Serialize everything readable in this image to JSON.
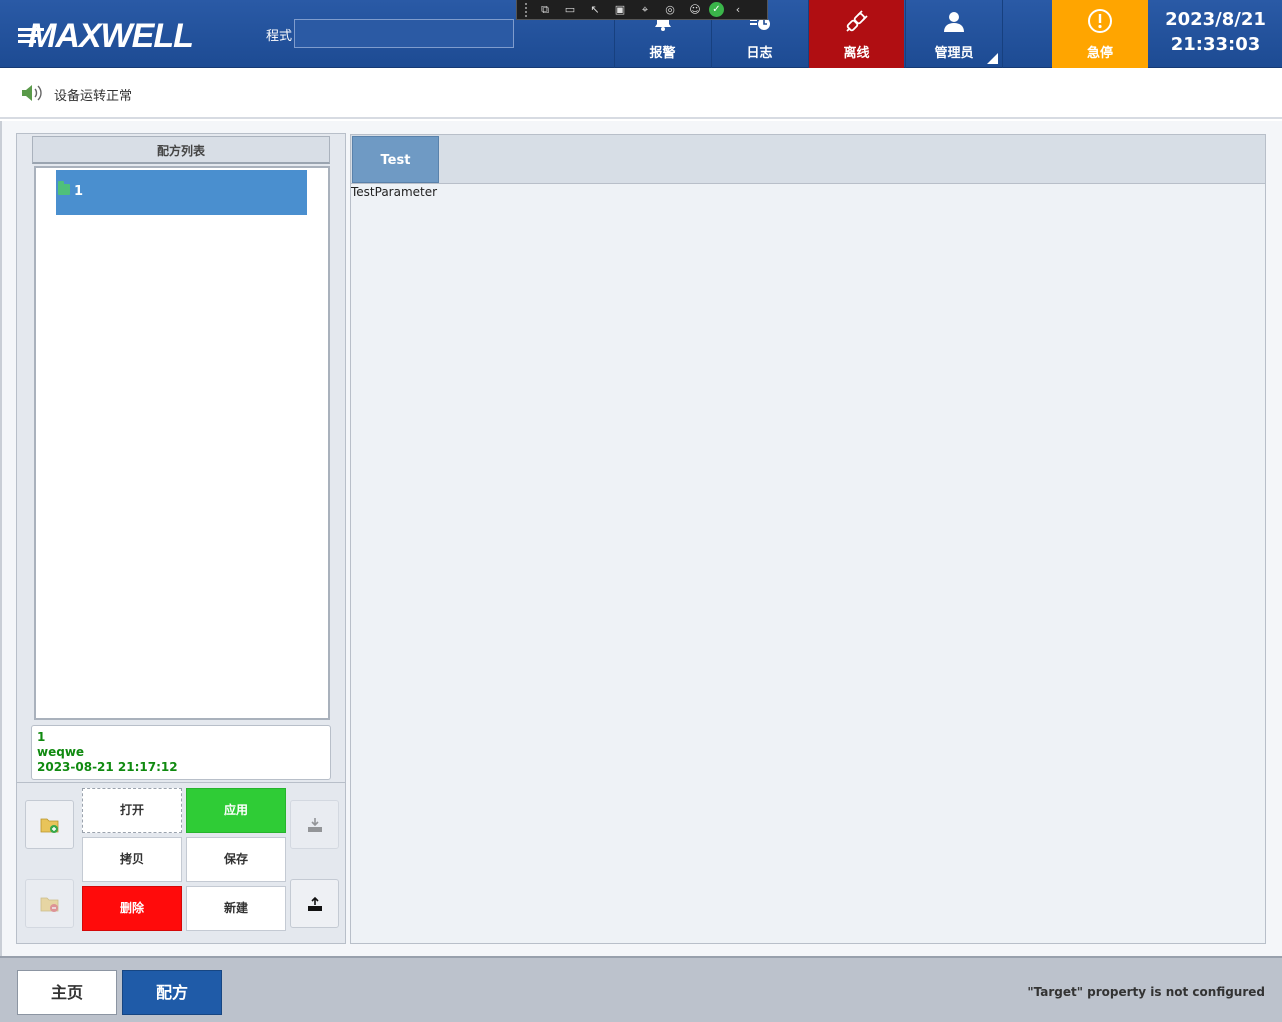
{
  "header": {
    "logo_text": "MAXWELL",
    "program_label": "程式",
    "program_value": "",
    "buttons": {
      "alarm": "报警",
      "log": "日志",
      "offline": "离线",
      "admin": "管理员",
      "estop": "急停"
    },
    "date": "2023/8/21",
    "time": "21:33:03",
    "colors": {
      "header_bg": "#1d4b93",
      "offline_bg": "#b00e12",
      "estop_bg": "#ffa500"
    }
  },
  "debug_toolbar": {
    "icons": [
      "live-visual-tree-icon",
      "record-icon",
      "select-element-icon",
      "display-layout-adorners-icon",
      "track-focus-icon",
      "binding-failures-icon",
      "accessibility-icon",
      "check-icon",
      "collapse-icon"
    ]
  },
  "status": {
    "message": "设备运转正常"
  },
  "recipe_list": {
    "header": "配方列表",
    "items": [
      {
        "label": "1"
      }
    ],
    "info": {
      "name": "1",
      "description": "weqwe",
      "timestamp": "2023-08-21 21:17:12"
    }
  },
  "actions": {
    "open": "打开",
    "apply": "应用",
    "copy": "拷贝",
    "save": "保存",
    "delete": "删除",
    "new": "新建",
    "colors": {
      "apply": "#2fcc36",
      "delete": "#ff0b0b"
    }
  },
  "editor": {
    "tabs": [
      {
        "label": "Test"
      }
    ],
    "parameter_label": "TestParameter"
  },
  "bottom_nav": {
    "home": "主页",
    "recipe": "配方",
    "warning": "\"Target\" property is not configured"
  }
}
